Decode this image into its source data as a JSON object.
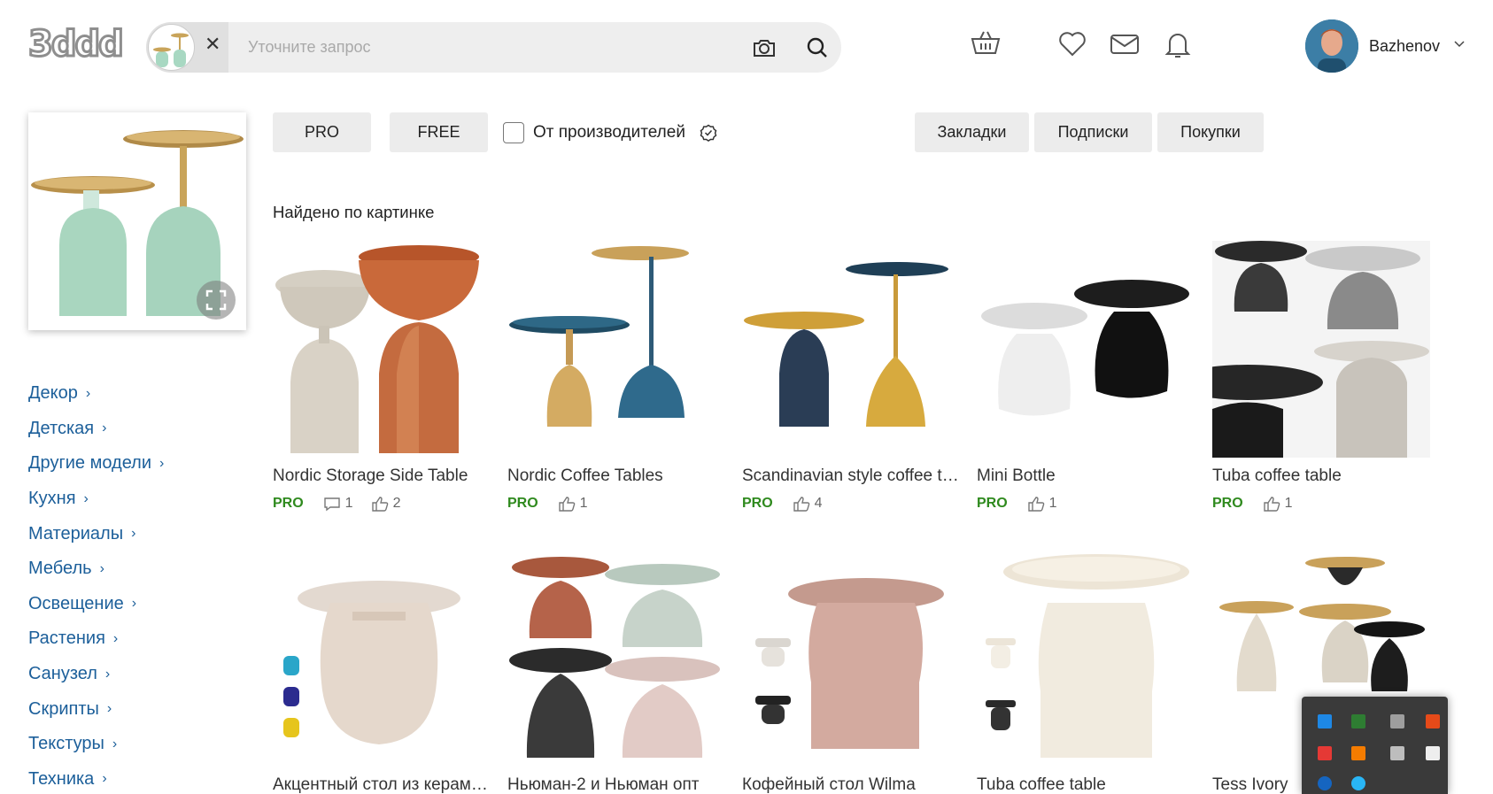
{
  "header": {
    "logo": "3ddd",
    "search": {
      "placeholder": "Уточните запрос",
      "value": ""
    },
    "user": {
      "name": "Bazhenov"
    }
  },
  "filters": {
    "pro": "PRO",
    "free": "FREE",
    "manufacturers": "От производителей",
    "bookmarks": "Закладки",
    "subscriptions": "Подписки",
    "purchases": "Покупки"
  },
  "found_title": "Найдено по картинке",
  "categories": [
    "Декор",
    "Детская",
    "Другие модели",
    "Кухня",
    "Материалы",
    "Мебель",
    "Освещение",
    "Растения",
    "Санузел",
    "Скрипты",
    "Текстуры",
    "Техника"
  ],
  "results": [
    {
      "title": "Nordic Storage Side Table",
      "badge": "PRO",
      "comments": "1",
      "likes": "2"
    },
    {
      "title": "Nordic Coffee Tables",
      "badge": "PRO",
      "likes": "1"
    },
    {
      "title": "Scandinavian style coffee table",
      "badge": "PRO",
      "likes": "4"
    },
    {
      "title": "Mini Bottle",
      "badge": "PRO",
      "likes": "1"
    },
    {
      "title": "Tuba coffee table",
      "badge": "PRO",
      "likes": "1"
    },
    {
      "title": "Акцентный стол из керамики"
    },
    {
      "title": "Ньюман-2 и Ньюман опт"
    },
    {
      "title": "Кофейный стол Wilma"
    },
    {
      "title": "Tuba coffee table"
    },
    {
      "title": "Tess Ivory"
    }
  ],
  "colors": {
    "accent_link": "#1c5f9a",
    "pro_badge": "#2f8a1e",
    "chip_bg": "#ececec"
  }
}
